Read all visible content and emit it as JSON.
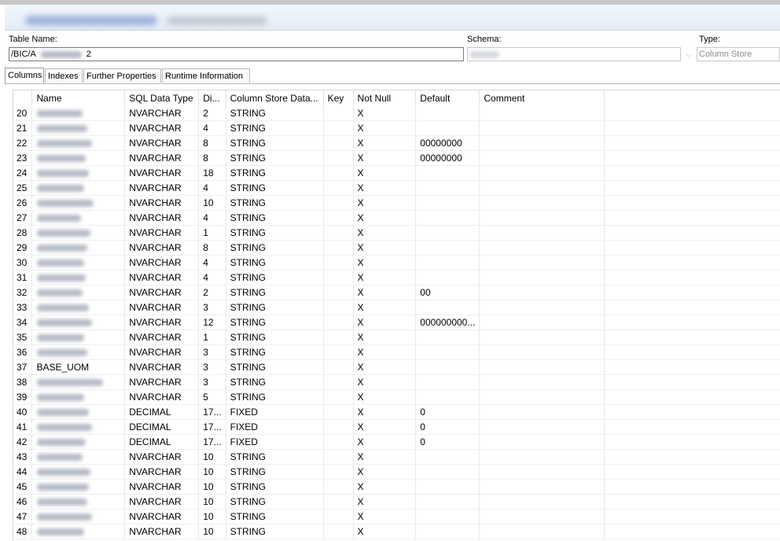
{
  "form": {
    "table_name_label": "Table Name:",
    "table_name_value": "/BIC/A",
    "table_name_suffix": "2",
    "schema_label": "Schema:",
    "type_label": "Type:",
    "type_value": "Column Store"
  },
  "tabs": [
    {
      "label": "Columns"
    },
    {
      "label": "Indexes"
    },
    {
      "label": "Further Properties"
    },
    {
      "label": "Runtime Information"
    }
  ],
  "columns": [
    "Name",
    "SQL Data Type",
    "Di...",
    "Column Store Data...",
    "Key",
    "Not Null",
    "Default",
    "Comment"
  ],
  "rows": [
    {
      "n": "20",
      "name": "",
      "sql": "NVARCHAR",
      "dim": "2",
      "cs": "STRING",
      "key": "",
      "nn": "X",
      "def": "",
      "com": ""
    },
    {
      "n": "21",
      "name": "",
      "sql": "NVARCHAR",
      "dim": "4",
      "cs": "STRING",
      "key": "",
      "nn": "X",
      "def": "",
      "com": ""
    },
    {
      "n": "22",
      "name": "",
      "sql": "NVARCHAR",
      "dim": "8",
      "cs": "STRING",
      "key": "",
      "nn": "X",
      "def": "00000000",
      "com": ""
    },
    {
      "n": "23",
      "name": "",
      "sql": "NVARCHAR",
      "dim": "8",
      "cs": "STRING",
      "key": "",
      "nn": "X",
      "def": "00000000",
      "com": ""
    },
    {
      "n": "24",
      "name": "",
      "sql": "NVARCHAR",
      "dim": "18",
      "cs": "STRING",
      "key": "",
      "nn": "X",
      "def": "",
      "com": ""
    },
    {
      "n": "25",
      "name": "",
      "sql": "NVARCHAR",
      "dim": "4",
      "cs": "STRING",
      "key": "",
      "nn": "X",
      "def": "",
      "com": ""
    },
    {
      "n": "26",
      "name": "",
      "sql": "NVARCHAR",
      "dim": "10",
      "cs": "STRING",
      "key": "",
      "nn": "X",
      "def": "",
      "com": ""
    },
    {
      "n": "27",
      "name": "",
      "sql": "NVARCHAR",
      "dim": "4",
      "cs": "STRING",
      "key": "",
      "nn": "X",
      "def": "",
      "com": ""
    },
    {
      "n": "28",
      "name": "",
      "sql": "NVARCHAR",
      "dim": "1",
      "cs": "STRING",
      "key": "",
      "nn": "X",
      "def": "",
      "com": ""
    },
    {
      "n": "29",
      "name": "",
      "sql": "NVARCHAR",
      "dim": "8",
      "cs": "STRING",
      "key": "",
      "nn": "X",
      "def": "",
      "com": ""
    },
    {
      "n": "30",
      "name": "",
      "sql": "NVARCHAR",
      "dim": "4",
      "cs": "STRING",
      "key": "",
      "nn": "X",
      "def": "",
      "com": ""
    },
    {
      "n": "31",
      "name": "",
      "sql": "NVARCHAR",
      "dim": "4",
      "cs": "STRING",
      "key": "",
      "nn": "X",
      "def": "",
      "com": ""
    },
    {
      "n": "32",
      "name": "",
      "sql": "NVARCHAR",
      "dim": "2",
      "cs": "STRING",
      "key": "",
      "nn": "X",
      "def": "00",
      "com": ""
    },
    {
      "n": "33",
      "name": "",
      "sql": "NVARCHAR",
      "dim": "3",
      "cs": "STRING",
      "key": "",
      "nn": "X",
      "def": "",
      "com": ""
    },
    {
      "n": "34",
      "name": "",
      "sql": "NVARCHAR",
      "dim": "12",
      "cs": "STRING",
      "key": "",
      "nn": "X",
      "def": "000000000...",
      "com": ""
    },
    {
      "n": "35",
      "name": "",
      "sql": "NVARCHAR",
      "dim": "1",
      "cs": "STRING",
      "key": "",
      "nn": "X",
      "def": "",
      "com": ""
    },
    {
      "n": "36",
      "name": "",
      "sql": "NVARCHAR",
      "dim": "3",
      "cs": "STRING",
      "key": "",
      "nn": "X",
      "def": "",
      "com": ""
    },
    {
      "n": "37",
      "name": "BASE_UOM",
      "sql": "NVARCHAR",
      "dim": "3",
      "cs": "STRING",
      "key": "",
      "nn": "X",
      "def": "",
      "com": ""
    },
    {
      "n": "38",
      "name": "",
      "sql": "NVARCHAR",
      "dim": "3",
      "cs": "STRING",
      "key": "",
      "nn": "X",
      "def": "",
      "com": ""
    },
    {
      "n": "39",
      "name": "",
      "sql": "NVARCHAR",
      "dim": "5",
      "cs": "STRING",
      "key": "",
      "nn": "X",
      "def": "",
      "com": ""
    },
    {
      "n": "40",
      "name": "",
      "sql": "DECIMAL",
      "dim": "17...",
      "cs": "FIXED",
      "key": "",
      "nn": "X",
      "def": "0",
      "com": ""
    },
    {
      "n": "41",
      "name": "",
      "sql": "DECIMAL",
      "dim": "17...",
      "cs": "FIXED",
      "key": "",
      "nn": "X",
      "def": "0",
      "com": ""
    },
    {
      "n": "42",
      "name": "",
      "sql": "DECIMAL",
      "dim": "17...",
      "cs": "FIXED",
      "key": "",
      "nn": "X",
      "def": "0",
      "com": ""
    },
    {
      "n": "43",
      "name": "",
      "sql": "NVARCHAR",
      "dim": "10",
      "cs": "STRING",
      "key": "",
      "nn": "X",
      "def": "",
      "com": ""
    },
    {
      "n": "44",
      "name": "",
      "sql": "NVARCHAR",
      "dim": "10",
      "cs": "STRING",
      "key": "",
      "nn": "X",
      "def": "",
      "com": ""
    },
    {
      "n": "45",
      "name": "",
      "sql": "NVARCHAR",
      "dim": "10",
      "cs": "STRING",
      "key": "",
      "nn": "X",
      "def": "",
      "com": ""
    },
    {
      "n": "46",
      "name": "",
      "sql": "NVARCHAR",
      "dim": "10",
      "cs": "STRING",
      "key": "",
      "nn": "X",
      "def": "",
      "com": ""
    },
    {
      "n": "47",
      "name": "",
      "sql": "NVARCHAR",
      "dim": "10",
      "cs": "STRING",
      "key": "",
      "nn": "X",
      "def": "",
      "com": ""
    },
    {
      "n": "48",
      "name": "",
      "sql": "NVARCHAR",
      "dim": "10",
      "cs": "STRING",
      "key": "",
      "nn": "X",
      "def": "",
      "com": ""
    }
  ]
}
